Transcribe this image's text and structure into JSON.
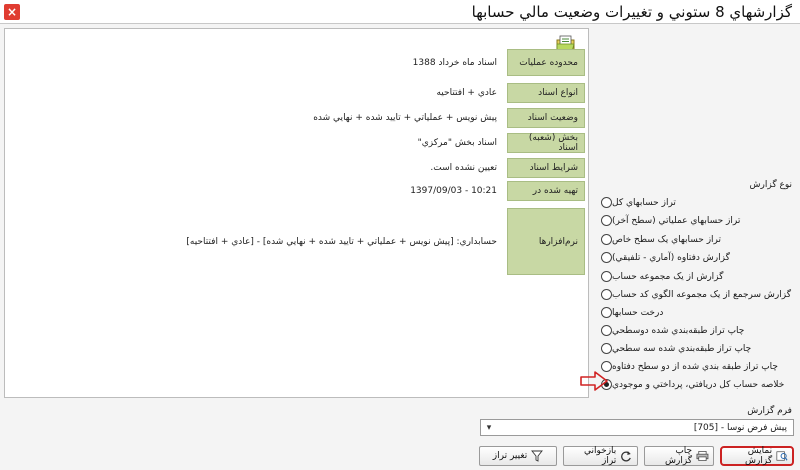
{
  "window": {
    "title": "گزارشهاي 8 ستوني و تغييرات وضعيت مالي حسابها",
    "close_symbol": "×"
  },
  "info_rows": [
    {
      "label": "محدوده عمليات",
      "value": "اسناد ماه خرداد 1388"
    },
    {
      "label": "انواع اسناد",
      "value": "عادي + افتتاحيه"
    },
    {
      "label": "وضعيت اسناد",
      "value": "پيش نويس + عملياتي + تاييد شده + نهايي شده"
    },
    {
      "label": "بخش (شعبه) اسناد",
      "value": "اسناد بخش \"مرکزي\""
    },
    {
      "label": "شرايط اسناد",
      "value": "تعيين نشده است."
    },
    {
      "label": "تهيه شده در",
      "value": "10:21 - 1397/09/03"
    },
    {
      "label": "نرم‌افزارها",
      "value": "حسابداري: [پيش نويس + عملياتي + تاييد شده + نهايي شده] - [عادي + افتتاحيه]"
    }
  ],
  "report_type": {
    "title": "نوع گزارش",
    "options": [
      "تراز حسابهاي کل",
      "تراز حسابهاي عملياتي (سطح آخر)",
      "تراز حسابهاي يک سطح خاص",
      "گزارش دفتاوه (آماري - تلفيقي)",
      "گزارش از يک مجموعه حساب",
      "گزارش سرجمع از يک مجموعه الگوي کد حساب",
      "درخت حسابها",
      "چاپ تراز طبقه‌بندي شده دوسطحي",
      "چاپ تراز طبقه‌بندي شده سه سطحي",
      "چاپ تراز طبقه بندي شده از دو سطح دفتاوه",
      "خلاصه حساب کل دريافتي، پرداختي و موجودي"
    ],
    "selected_index": 10
  },
  "report_form": {
    "label": "فرم گزارش",
    "selected": "پيش فرض نوسا - [705]"
  },
  "buttons": {
    "show": "نمايش گزارش",
    "print": "چاپ گزارش",
    "recall": "بازخواني تراز",
    "change": "تغيير تراز"
  },
  "colors": {
    "label_bg": "#c8d8a4",
    "highlight_border": "#cc2222",
    "arrow": "#d12424"
  },
  "icons": {
    "panel_icon": "report-folder-icon",
    "show": "magnifier-report-icon",
    "print": "printer-icon",
    "recall": "refresh-icon",
    "change": "filter-icon",
    "dropdown": "chevron-down-icon"
  }
}
